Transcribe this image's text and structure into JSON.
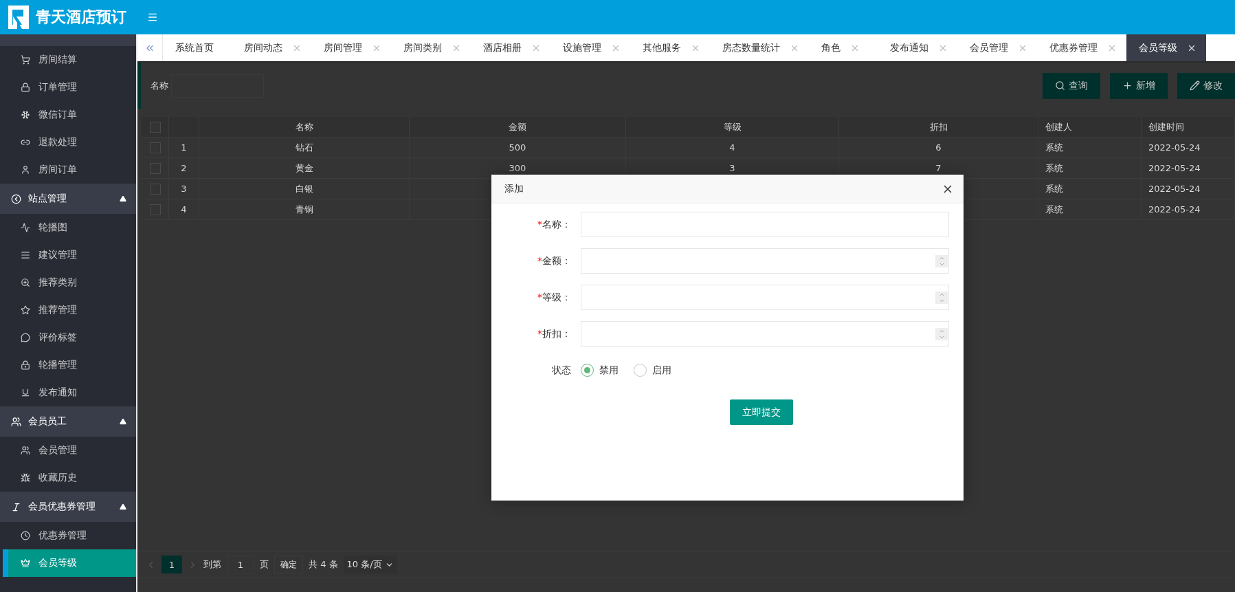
{
  "header": {
    "title": "青天酒店预订"
  },
  "sidebar": {
    "top_items": [
      {
        "label": "房间结算",
        "selected": false
      },
      {
        "label": "订单管理",
        "selected": false
      },
      {
        "label": "微信订单",
        "selected": false
      },
      {
        "label": "退款处理",
        "selected": false
      },
      {
        "label": "房间订单",
        "selected": false
      }
    ],
    "groups": [
      {
        "label": "站点管理",
        "expanded": true,
        "children": [
          {
            "label": "轮播图",
            "selected": false
          },
          {
            "label": "建议管理",
            "selected": false
          },
          {
            "label": "推荐类别",
            "selected": false
          },
          {
            "label": "推荐管理",
            "selected": false
          },
          {
            "label": "评价标签",
            "selected": false
          },
          {
            "label": "轮播管理",
            "selected": false
          },
          {
            "label": "发布通知",
            "selected": false
          }
        ]
      },
      {
        "label": "会员员工",
        "expanded": true,
        "children": [
          {
            "label": "会员管理",
            "selected": false
          },
          {
            "label": "收藏历史",
            "selected": false
          }
        ]
      },
      {
        "label": "会员优惠券管理",
        "expanded": true,
        "children": [
          {
            "label": "优惠券管理",
            "selected": false
          },
          {
            "label": "会员等级",
            "selected": true
          }
        ]
      }
    ]
  },
  "tabs": [
    {
      "label": "系统首页",
      "selected": false,
      "closable": false
    },
    {
      "label": "房间动态",
      "selected": false,
      "closable": true
    },
    {
      "label": "房间管理",
      "selected": false,
      "closable": true
    },
    {
      "label": "房间类别",
      "selected": false,
      "closable": true
    },
    {
      "label": "酒店相册",
      "selected": false,
      "closable": true
    },
    {
      "label": "设施管理",
      "selected": false,
      "closable": true
    },
    {
      "label": "其他服务",
      "selected": false,
      "closable": true
    },
    {
      "label": "房态数量统计",
      "selected": false,
      "closable": true
    },
    {
      "label": "角色",
      "selected": false,
      "closable": true
    },
    {
      "label": "发布通知",
      "selected": false,
      "closable": true
    },
    {
      "label": "会员管理",
      "selected": false,
      "closable": true
    },
    {
      "label": "优惠券管理",
      "selected": false,
      "closable": true
    },
    {
      "label": "会员等级",
      "selected": true,
      "closable": true
    }
  ],
  "filter": {
    "label": "名称"
  },
  "toolbar": [
    {
      "kind": "search",
      "label": "查询"
    },
    {
      "kind": "add",
      "label": "新增"
    },
    {
      "kind": "edit",
      "label": "修改"
    }
  ],
  "table": {
    "header_checkbox": {
      "checked": false
    },
    "columns": [
      "名称",
      "金额",
      "等级",
      "折扣",
      "创建人",
      "创建时间"
    ],
    "rows": [
      {
        "checked": false,
        "index": "1",
        "name": "钻石",
        "amount": "500",
        "level": "4",
        "discount": "6",
        "creator": "系统",
        "created": "2022-05-24"
      },
      {
        "checked": false,
        "index": "2",
        "name": "黄金",
        "amount": "300",
        "level": "3",
        "discount": "7",
        "creator": "系统",
        "created": "2022-05-24"
      },
      {
        "checked": false,
        "index": "3",
        "name": "白银",
        "creator": "系统",
        "created": "2022-05-24"
      },
      {
        "checked": false,
        "index": "4",
        "name": "青铜",
        "creator": "系统",
        "created": "2022-05-24"
      }
    ]
  },
  "pagination": {
    "pages": [
      {
        "label": "1",
        "selected": true
      }
    ],
    "goto_label": "到第",
    "goto_value": "1",
    "page_unit": "页",
    "confirm": "确定",
    "total": "共 4 条",
    "page_size": "10 条/页"
  },
  "dialog": {
    "title": "添加",
    "fields": [
      {
        "mark": "*",
        "label": "名称：",
        "kind": "text"
      },
      {
        "mark": "*",
        "label": "金额：",
        "kind": "number"
      },
      {
        "mark": "*",
        "label": "等级：",
        "kind": "number"
      },
      {
        "mark": "*",
        "label": "折扣：",
        "kind": "number"
      }
    ],
    "status": {
      "label": "状态",
      "options": [
        {
          "label": "禁用",
          "selected": true
        },
        {
          "label": "启用",
          "selected": false
        }
      ]
    },
    "submit": "立即提交"
  }
}
